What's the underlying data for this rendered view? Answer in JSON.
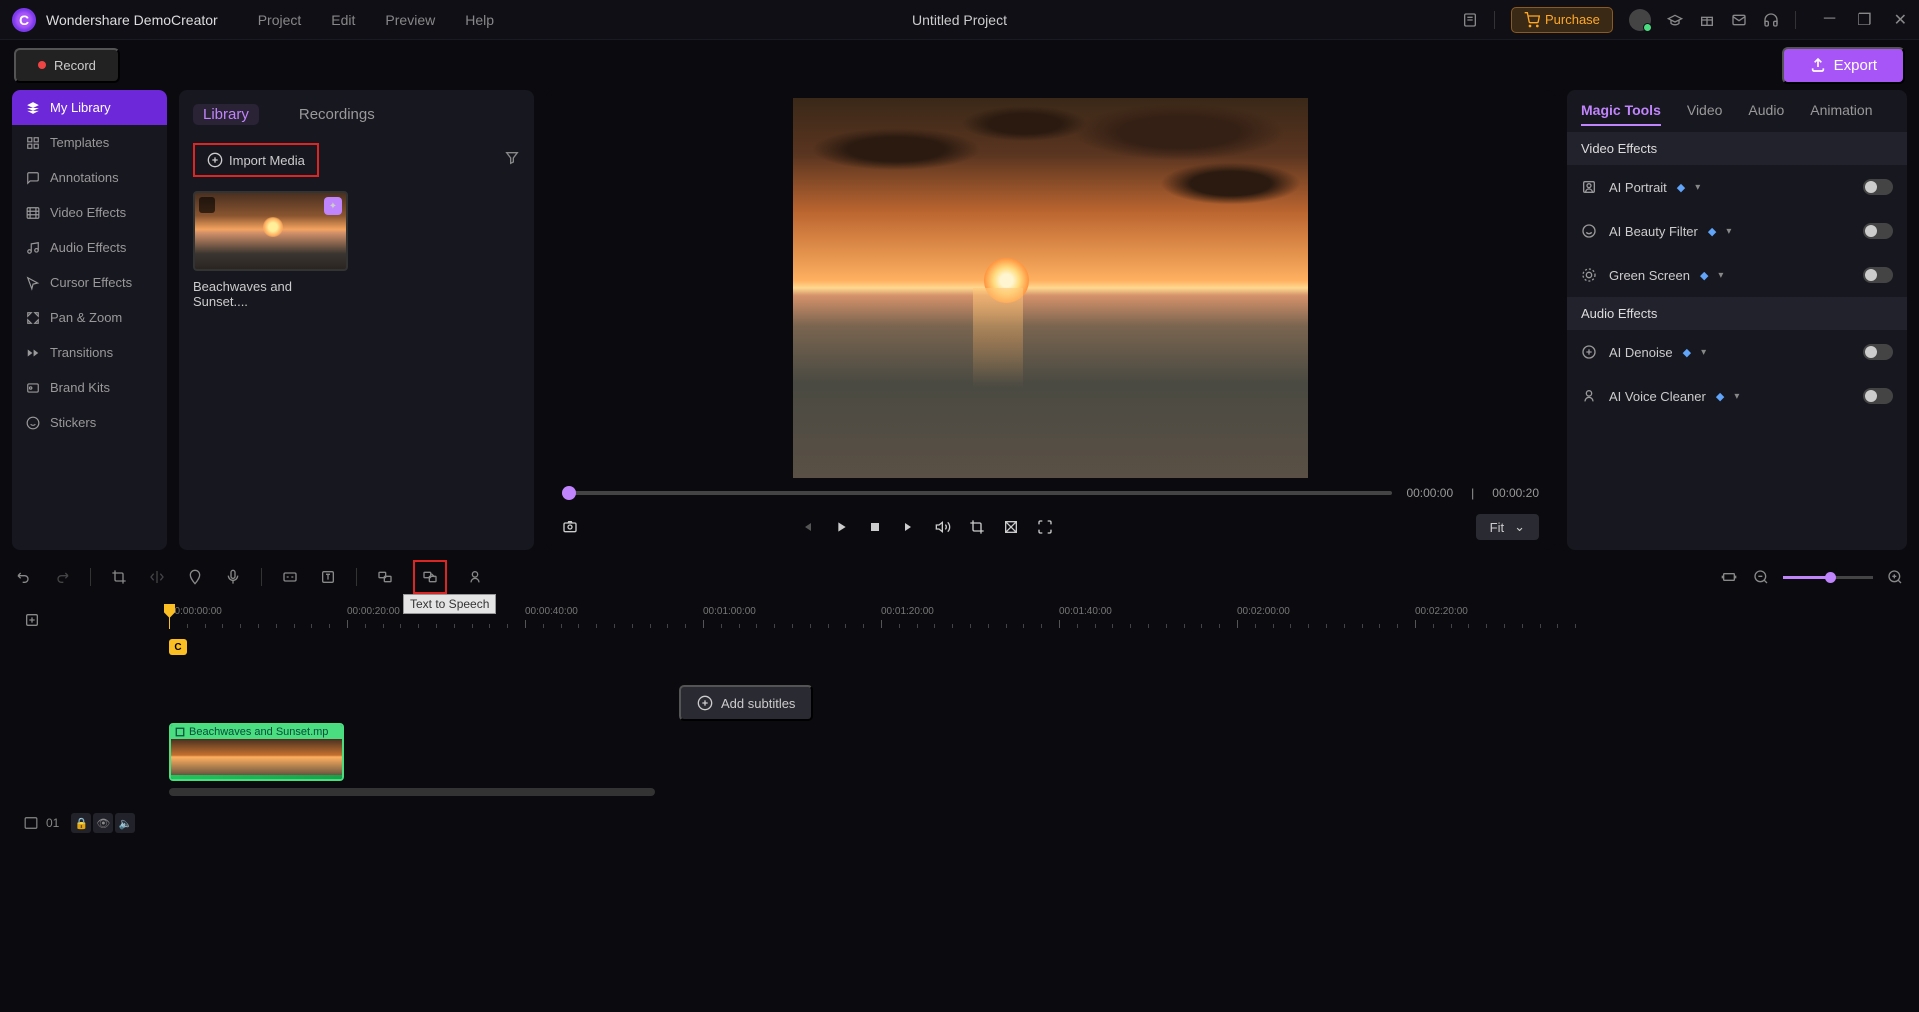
{
  "app": {
    "name": "Wondershare DemoCreator",
    "project_title": "Untitled Project"
  },
  "menus": [
    "Project",
    "Edit",
    "Preview",
    "Help"
  ],
  "titlebar": {
    "purchase": "Purchase"
  },
  "actions": {
    "record": "Record",
    "export": "Export"
  },
  "sidebar": {
    "items": [
      {
        "label": "My Library",
        "icon": "layers"
      },
      {
        "label": "Templates",
        "icon": "grid"
      },
      {
        "label": "Annotations",
        "icon": "message"
      },
      {
        "label": "Video Effects",
        "icon": "film"
      },
      {
        "label": "Audio Effects",
        "icon": "music"
      },
      {
        "label": "Cursor Effects",
        "icon": "cursor"
      },
      {
        "label": "Pan & Zoom",
        "icon": "zoom"
      },
      {
        "label": "Transitions",
        "icon": "transition"
      },
      {
        "label": "Brand Kits",
        "icon": "brand"
      },
      {
        "label": "Stickers",
        "icon": "sticker"
      }
    ]
  },
  "media": {
    "tabs": [
      "Library",
      "Recordings"
    ],
    "import_label": "Import Media",
    "thumb_name": "Beachwaves and Sunset...."
  },
  "preview": {
    "current_time": "00:00:00",
    "total_time": "00:00:20",
    "fit_label": "Fit"
  },
  "props": {
    "tabs": [
      "Magic Tools",
      "Video",
      "Audio",
      "Animation"
    ],
    "video_section": "Video Effects",
    "audio_section": "Audio Effects",
    "items": {
      "ai_portrait": "AI Portrait",
      "ai_beauty": "AI Beauty Filter",
      "green_screen": "Green Screen",
      "ai_denoise": "AI Denoise",
      "ai_voice_cleaner": "AI Voice Cleaner"
    }
  },
  "timeline": {
    "tooltip": "Text to Speech",
    "ruler_labels": [
      "00:00:00:00",
      "00:00:20:00",
      "00:00:40:00",
      "00:01:00:00",
      "00:01:20:00",
      "00:01:40:00",
      "00:02:00:00",
      "00:02:20:00"
    ],
    "add_subtitles": "Add subtitles",
    "cursor_marker": "C",
    "clip_name": "Beachwaves and Sunset.mp",
    "track_num": "01"
  }
}
